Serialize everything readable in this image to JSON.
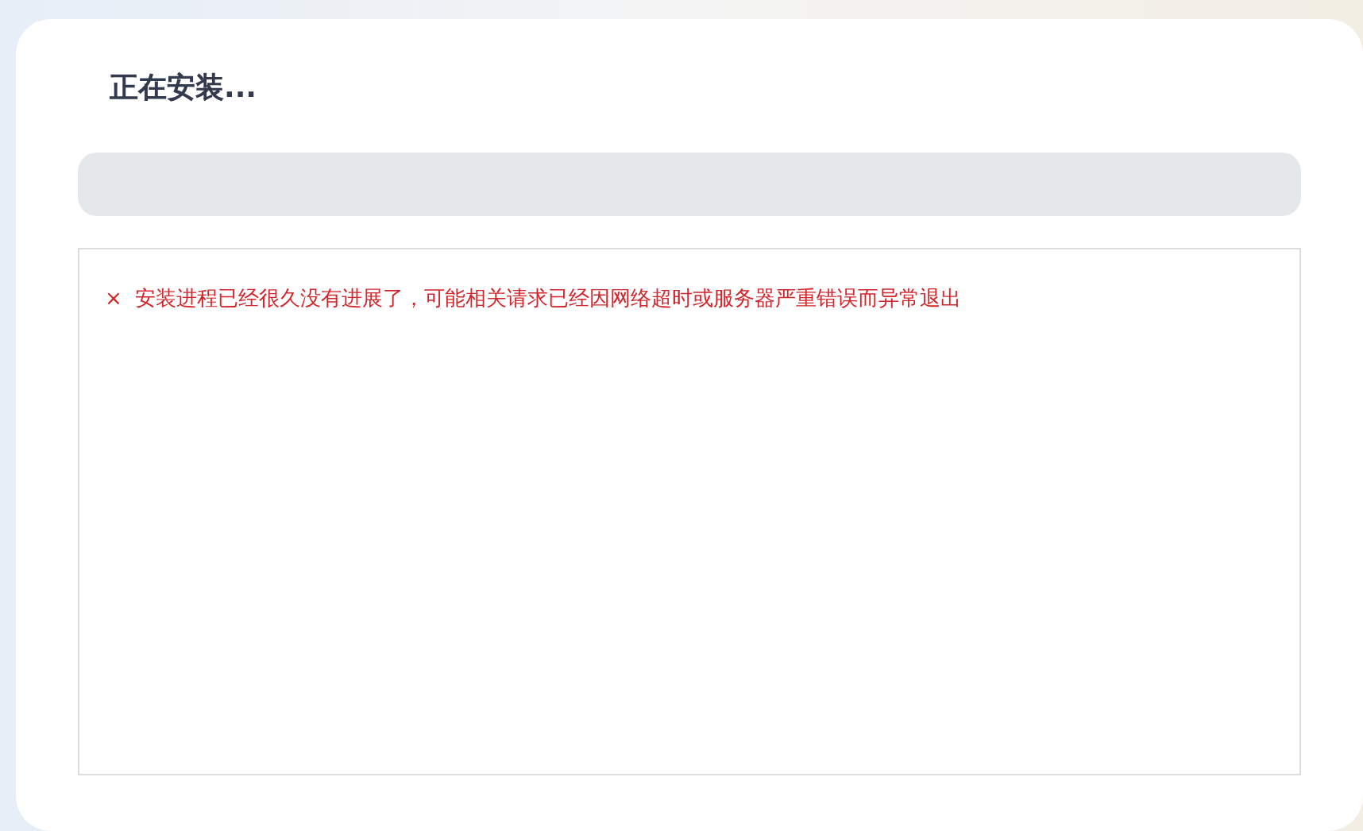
{
  "title": "正在安装...",
  "progress": {
    "level": 0
  },
  "log": [
    {
      "kind": "error",
      "icon": "×",
      "text": "安装进程已经很久没有进展了，可能相关请求已经因网络超时或服务器严重错误而异常退出"
    }
  ]
}
